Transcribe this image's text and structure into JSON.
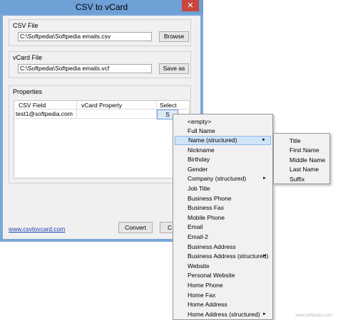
{
  "window": {
    "title": "CSV to vCard",
    "close_glyph": "✕"
  },
  "csv_file": {
    "group_label": "CSV File",
    "path": "C:\\Softpedia\\Softpedia emails.csv",
    "browse_label": "Browse"
  },
  "vcard_file": {
    "group_label": "vCard File",
    "path": "C:\\Softpedia\\Softpedia emails.vcf",
    "save_label": "Save as"
  },
  "properties": {
    "group_label": "Properties",
    "columns": [
      "CSV Field",
      "vCard Property",
      "Select"
    ],
    "rows": [
      {
        "csv_field": "test1@softpedia.com",
        "vcard_property": "",
        "select": "S"
      }
    ]
  },
  "footer": {
    "link": "www.csvtovcard.com",
    "convert_label": "Convert",
    "close_label": "C"
  },
  "context_menu": {
    "items": [
      {
        "label": "<empty>",
        "has_submenu": false
      },
      {
        "label": "Full Name",
        "has_submenu": false
      },
      {
        "label": "Name (structured)",
        "has_submenu": true,
        "highlighted": true
      },
      {
        "label": "Nickname",
        "has_submenu": false
      },
      {
        "label": "Birthday",
        "has_submenu": false
      },
      {
        "label": "Gender",
        "has_submenu": false
      },
      {
        "label": "Company (structured)",
        "has_submenu": true
      },
      {
        "label": "Job Title",
        "has_submenu": false
      },
      {
        "label": "Business Phone",
        "has_submenu": false
      },
      {
        "label": "Business Fax",
        "has_submenu": false
      },
      {
        "label": "Mobile Phone",
        "has_submenu": false
      },
      {
        "label": "Email",
        "has_submenu": false
      },
      {
        "label": "Email-2",
        "has_submenu": false
      },
      {
        "label": "Business Address",
        "has_submenu": false
      },
      {
        "label": "Business Address (structured)",
        "has_submenu": true
      },
      {
        "label": "Website",
        "has_submenu": false
      },
      {
        "label": "Personal Website",
        "has_submenu": false
      },
      {
        "label": "Home Phone",
        "has_submenu": false
      },
      {
        "label": "Home Fax",
        "has_submenu": false
      },
      {
        "label": "Home Address",
        "has_submenu": false
      },
      {
        "label": "Home Address (structured)",
        "has_submenu": true
      }
    ],
    "submenu_arrow": "►"
  },
  "submenu": {
    "items": [
      "Title",
      "First Name",
      "Middle Name",
      "Last Name",
      "Suffix"
    ]
  },
  "watermark": "www.softpedia.com",
  "colors": {
    "title_bar": "#6fa0d6",
    "close_button": "#c9463d",
    "highlight": "#cfe3f9",
    "link": "#1a3fb5"
  }
}
